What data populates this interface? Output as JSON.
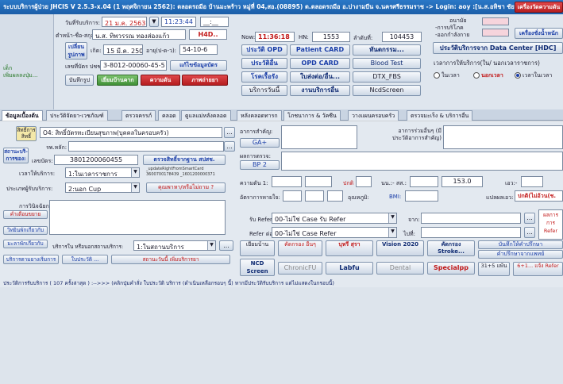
{
  "window": {
    "title": "ระบบบริการผู้ป่วย JHCIS V 2.5.3-x.04 (1 พฤศจิกายน 2562): ตลอดรถมีอ บ้านมะพร้าว หมู่ที่ 04,สอ.(08895) ต.ตลอดรถมีอ อ.บ่างามบีน จ.นครศรีธรรมราช -> Login: aoy :[น.ส.อทิชา ชัยมะ]",
    "right_button": "เครื่องวัดความดัน"
  },
  "left_sidebar": {
    "label1": "เด็ก",
    "label2": "เพิ่มผลลงปุ่ม..."
  },
  "patient": {
    "visit_date_label": "วันที่รับบริการ:",
    "visit_date": "21 ม.ค. 2563",
    "visit_time": "11:23:44",
    "blank_time": "__:__",
    "village_label": "ตำหน้า-ชื่อ-สกุล:",
    "name": "น.ส. ทิพวรรณ ทองส่องแก้ว",
    "hn_badge": "H4D..",
    "change_label": "เปลี่ยน",
    "pic_label": "รูปภาพ",
    "birth_label": "เกิด:",
    "birth": "15 มี.ค. 2508",
    "age_label": "อายุ(ป-ด-ว):",
    "age": "54-10-6",
    "id_label": "เลขที่บัตร ปชช:",
    "id": "3-8012-00060-45-5",
    "edit_id": "แก้ไขข้อมูลบัตร",
    "save_btn": "บันทึกรูป",
    "status_green": "เยี่ยมบ้านคาก",
    "risk_btn": "ความดัน",
    "allergy_btn": "ภาพถ่ายยา"
  },
  "now_panel": {
    "now_label": "Now:",
    "now_time": "11:36:18",
    "hn_label": "HN:",
    "hn": "1553",
    "seq_label": "ลำดับที่:",
    "seq": "104453",
    "opd_history": "ประวัติ OPD",
    "patient_card": "Patient CARD",
    "dental": "ทันตกรรม...",
    "history": "ประวัติอื่น",
    "opd_card": "OPD CARD",
    "blood_test": "Blood Test",
    "disease": "โรคเรื้อรัง",
    "refer": "ใบส่งต่อ/อื่น...",
    "dtx": "DTX_FBS",
    "service_today": "บริการวันนี้",
    "service_other": "งานบริการอื่น",
    "ncd_screen": "NcdScreen"
  },
  "right_panel": {
    "label_a": "อนามัย",
    "label_b": "-การบริโภค",
    "label_c": "-ออกกำลังกาย",
    "weight_btn": "เครื่องชั่งน้ำหนัก",
    "data_center": "ประวัติบริการจาก Data Center [HDC]",
    "service_time_label": "เวลาการให้บริการ(ใน/ นอกเวลาราชการ)",
    "opt_in": "ในเวลา",
    "opt_out": "นอกเวลา",
    "opt_in2": "เวลาในเวลา"
  },
  "tabs": [
    "ข้อมูลเบื้องต้น",
    "ประวัติจัดยา-เวชภัณฑ์",
    "ตรวจครรภ์",
    "คลอด",
    "ดูแลแม่หลังคลอด",
    "หลังคลอดทารก",
    "โภชนาการ & วัคซีน",
    "วางแผนครอบครัว",
    "ตรวจมะเร็ง & บริการอื่น"
  ],
  "form": {
    "right_label": "สิทธิ์การ สิทธิ์",
    "right_value": "O4: สิทธิ์บัตรทะเบียนสุขภาพ(บุคคลในครอบครัว)",
    "hospital_label": "รพ.หลัก:",
    "card_label": "สถานะบริ-การของ:",
    "card_no_label": "เลขบัตร:",
    "card_no": "3801200060455",
    "check_right": "ตรวจสิทธิ์จากฐาน สปสช.",
    "visit_time_label": "เวลาให้บริการ:",
    "visit_time_value": "1:ในเวลาราชการ",
    "smartcard_note": "_updateRightFromSmartCard",
    "smartcard_note2": "3600700178439 _1601200000371",
    "type_label": "ประเภทผู้รับบริการ:",
    "type_value": "2:นอก Cup",
    "history_btn": "คุณพาหา/หรือไม่ถาม ?",
    "diag_label": "การวินิจฉัยกรา:",
    "diag_red": "คำเตือนขยาย",
    "refer_btn": "วิทยินพักเกี่ยวกับ",
    "service_place_label": "บริการใน หรือนอกสถานบริการ:",
    "service_place": "1:ในสถานบริการ",
    "diag_btn2": "มะลาพักเกี่ยวกับ",
    "service_reason": "บริการตามยางเริ่มการ",
    "med_btn": "ใบประวัติ ...",
    "visit_btn": "สถานะวันนี้ เพิ่มบริการยา"
  },
  "vitals": {
    "chief_label": "อาการสำคัญ:",
    "cc_label": "อาการร่วมอื่นๆ (มีประวัติอาการสำคัญ)",
    "ga_btn": "GA+",
    "exam_label": "ผลการตรวจ:",
    "bp_label": "BP 2",
    "pressure_label": "ความดัน 1:",
    "pulse_label": "ชีพจร:",
    "temp_label": "อุณหภูมิ:",
    "weight_label": "นน.:- สส.:",
    "height": "153.0",
    "waist_label": "เอว:-",
    "bmi_label": "BMI:",
    "breath_label": "อัตราการหายใจ:",
    "pulse_unit": "ปกติ",
    "risk_label": "แปลผลเอว:",
    "risk_value": "ปกติ(ไม่อ้วน(ช.",
    "refer_out_label": "รับ Refer:",
    "refer_out_value": "00-ไม่ใช่ Case รับ Refer",
    "from_label": "จาก:",
    "refer_to_label": "Refer ต่อ:",
    "refer_to_value": "00-ไม่ใช่ Case Refer",
    "to_label": "ไปที่:",
    "side_red1": "ผลการ",
    "side_red2": "การ",
    "side_red3": "Refer"
  },
  "action_buttons": {
    "home_visit": "เยี่ยมบ้าน",
    "screening": "คัดกรอง อื่นๆ",
    "thalassemia": "บุหรี่ สุรา",
    "vision": "Vision 2020",
    "screen_stroke": "คัดกรอง Stroke...",
    "note_record": "บันทึกให้คำปรึกษา",
    "doctor_record": "คำปรึกษาจากแพทย์",
    "ncd_screen": "NCD Screen",
    "chronic_fu": "ChronicFU",
    "labfu": "Labfu",
    "dental": "Dental",
    "specialpp": "Specialpp",
    "age_btn": "31+5 แพ้น",
    "refer_btn": "6+1... แจ้ง Refer"
  },
  "footer": {
    "text": "ประวัติการรับบริการ ( 107 ครั้งล่าสุด ) :-->>> (คลิกปุ่มคำสั่ง ใบประวัติ บริการ (ดำเนินเหลือกรอบๆ นี้) หากมีประวัติรับบริการ แต่ไม่แสดงในกรอบนี้)"
  }
}
